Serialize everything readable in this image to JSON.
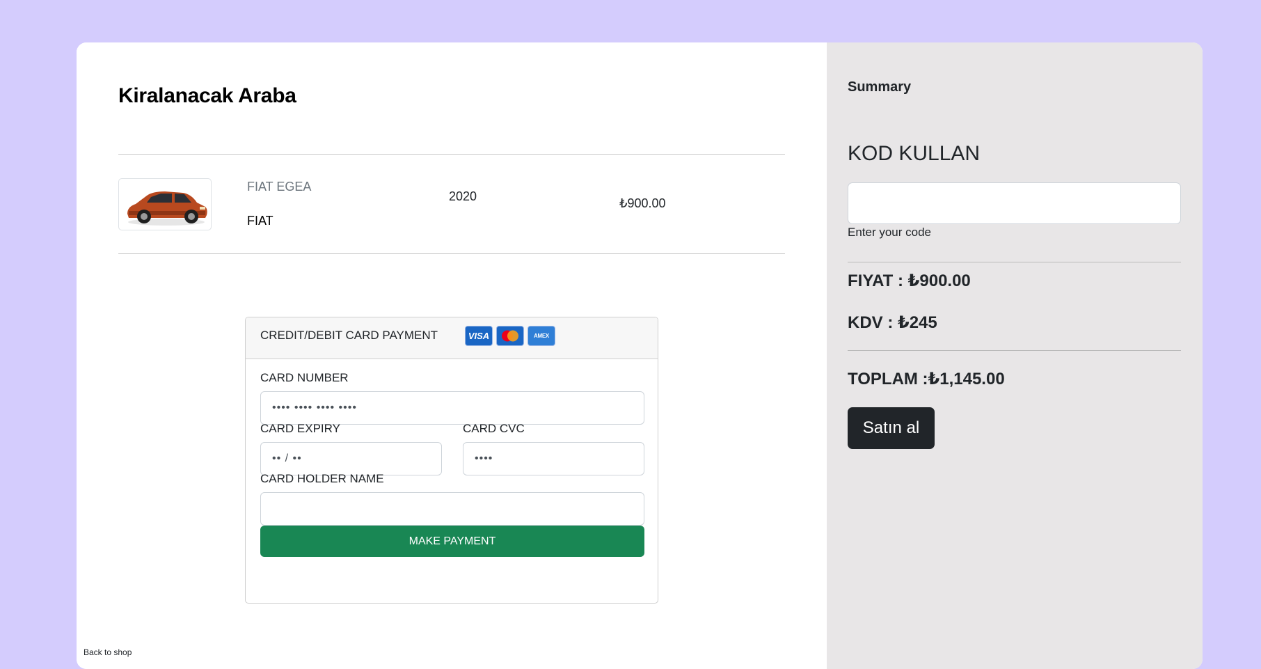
{
  "cart": {
    "title": "Kiralanacak Araba",
    "item": {
      "model": "FIAT EGEA",
      "brand": "FIAT",
      "year": "2020",
      "price": "₺900.00"
    },
    "back_link": "Back to shop"
  },
  "payment": {
    "header": "CREDIT/DEBIT CARD PAYMENT",
    "logos": {
      "visa": "VISA",
      "amex": "AMEX"
    },
    "card_number_label": "CARD NUMBER",
    "card_number_placeholder": "•••• •••• •••• ••••",
    "expiry_label": "CARD EXPIRY",
    "expiry_placeholder": "•• / ••",
    "cvc_label": "CARD CVC",
    "cvc_placeholder": "••••",
    "holder_label": "CARD HOLDER NAME",
    "holder_value": "",
    "button_label": "MAKE PAYMENT"
  },
  "summary": {
    "title": "Summary",
    "code_title": "KOD KULLAN",
    "code_value": "",
    "code_hint": "Enter your code",
    "price_line": "FIYAT : ₺900.00",
    "tax_line": "KDV : ₺245",
    "total_line": "TOPLAM :₺1,145.00",
    "buy_button": "Satın al"
  },
  "colors": {
    "page_background": "#d4ccfd",
    "summary_background": "#e8e6e7",
    "pay_button": "#198754",
    "buy_button": "#212529"
  }
}
